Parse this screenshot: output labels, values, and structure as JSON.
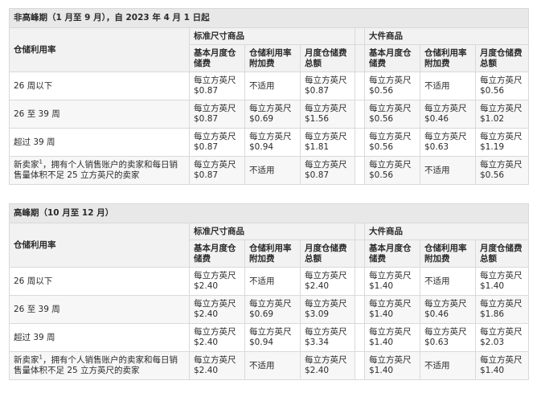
{
  "column_headers": {
    "storage_rate": "仓储利用率",
    "standard_group": "标准尺寸商品",
    "oversize_group": "大件商品",
    "base_fee": "基本月度仓储费",
    "surcharge": "仓储利用率附加费",
    "total": "月度仓储费总额"
  },
  "sections": [
    {
      "title": "非高峰期（1 月至 9 月），自 2023 年 4 月 1 日起",
      "rows": [
        {
          "label": "26 周以下",
          "standard": [
            {
              "unit": "每立方英尺",
              "value": "$0.87"
            },
            {
              "text": "不适用"
            },
            {
              "unit": "每立方英尺",
              "value": "$0.87"
            }
          ],
          "oversize": [
            {
              "unit": "每立方英尺",
              "value": "$0.56"
            },
            {
              "text": "不适用"
            },
            {
              "unit": "每立方英尺",
              "value": "$0.56"
            }
          ]
        },
        {
          "label": "26 至 39 周",
          "standard": [
            {
              "unit": "每立方英尺",
              "value": "$0.87"
            },
            {
              "unit": "每立方英尺",
              "value": "$0.69"
            },
            {
              "unit": "每立方英尺",
              "value": "$1.56"
            }
          ],
          "oversize": [
            {
              "unit": "每立方英尺",
              "value": "$0.56"
            },
            {
              "unit": "每立方英尺",
              "value": "$0.46"
            },
            {
              "unit": "每立方英尺",
              "value": "$1.02"
            }
          ]
        },
        {
          "label": "超过 39 周",
          "standard": [
            {
              "unit": "每立方英尺",
              "value": "$0.87"
            },
            {
              "unit": "每立方英尺",
              "value": "$0.94"
            },
            {
              "unit": "每立方英尺",
              "value": "$1.81"
            }
          ],
          "oversize": [
            {
              "unit": "每立方英尺",
              "value": "$0.56"
            },
            {
              "unit": "每立方英尺",
              "value": "$0.63"
            },
            {
              "unit": "每立方英尺",
              "value": "$1.19"
            }
          ]
        },
        {
          "label_prefix": "新卖家",
          "label_sup": "1",
          "label_suffix": "，拥有个人销售账户的卖家和每日销售量体积不足 25 立方英尺的卖家",
          "standard": [
            {
              "unit": "每立方英尺",
              "value": "$0.87"
            },
            {
              "text": "不适用"
            },
            {
              "unit": "每立方英尺",
              "value": "$0.87"
            }
          ],
          "oversize": [
            {
              "unit": "每立方英尺",
              "value": "$0.56"
            },
            {
              "text": "不适用"
            },
            {
              "unit": "每立方英尺",
              "value": "$0.56"
            }
          ]
        }
      ]
    },
    {
      "title": "高峰期（10 月至 12 月）",
      "rows": [
        {
          "label": "26 周以下",
          "standard": [
            {
              "unit": "每立方英尺",
              "value": "$2.40"
            },
            {
              "text": "不适用"
            },
            {
              "unit": "每立方英尺",
              "value": "$2.40"
            }
          ],
          "oversize": [
            {
              "unit": "每立方英尺",
              "value": "$1.40"
            },
            {
              "text": "不适用"
            },
            {
              "unit": "每立方英尺",
              "value": "$1.40"
            }
          ]
        },
        {
          "label": "26 至 39 周",
          "standard": [
            {
              "unit": "每立方英尺",
              "value": "$2.40"
            },
            {
              "unit": "每立方英尺",
              "value": "$0.69"
            },
            {
              "unit": "每立方英尺",
              "value": "$3.09"
            }
          ],
          "oversize": [
            {
              "unit": "每立方英尺",
              "value": "$1.40"
            },
            {
              "unit": "每立方英尺",
              "value": "$0.46"
            },
            {
              "unit": "每立方英尺",
              "value": "$1.86"
            }
          ]
        },
        {
          "label": "超过 39 周",
          "standard": [
            {
              "unit": "每立方英尺",
              "value": "$2.40"
            },
            {
              "unit": "每立方英尺",
              "value": "$0.94"
            },
            {
              "unit": "每立方英尺",
              "value": "$3.34"
            }
          ],
          "oversize": [
            {
              "unit": "每立方英尺",
              "value": "$1.40"
            },
            {
              "unit": "每立方英尺",
              "value": "$0.63"
            },
            {
              "unit": "每立方英尺",
              "value": "$2.03"
            }
          ]
        },
        {
          "label_prefix": "新卖家",
          "label_sup": "1",
          "label_suffix": "，拥有个人销售账户的卖家和每日销售量体积不足 25 立方英尺的卖家",
          "standard": [
            {
              "unit": "每立方英尺",
              "value": "$2.40"
            },
            {
              "text": "不适用"
            },
            {
              "unit": "每立方英尺",
              "value": "$2.40"
            }
          ],
          "oversize": [
            {
              "unit": "每立方英尺",
              "value": "$1.40"
            },
            {
              "text": "不适用"
            },
            {
              "unit": "每立方英尺",
              "value": "$1.40"
            }
          ]
        }
      ]
    }
  ]
}
